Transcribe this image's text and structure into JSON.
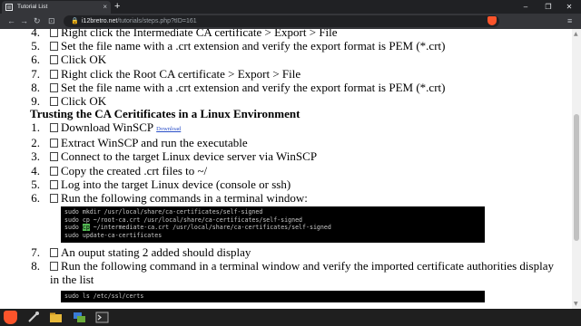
{
  "browser": {
    "tab_title": "Tutorial List",
    "tab_close": "×",
    "new_tab": "+",
    "address_domain": "i12bretro.net",
    "address_path": "/tutorials/steps.php?tID=161",
    "lock": "🔒"
  },
  "nav": {
    "back": "←",
    "forward": "→",
    "reload": "↻",
    "bookmark": "⊡",
    "menu": "≡"
  },
  "window": {
    "minimize": "–",
    "maximize": "❐",
    "close": "✕"
  },
  "list1": [
    {
      "num": "4.",
      "text": "Right click the Intermediate CA certificate > Export > File"
    },
    {
      "num": "5.",
      "text": "Set the file name with a .crt extension and verify the export format is PEM (*.crt)"
    },
    {
      "num": "6.",
      "text": "Click OK"
    },
    {
      "num": "7.",
      "text": "Right click the Root CA certificate > Export > File"
    },
    {
      "num": "8.",
      "text": "Set the file name with a .crt extension and verify the export format is PEM (*.crt)"
    },
    {
      "num": "9.",
      "text": "Click OK"
    }
  ],
  "heading": "Trusting the CA Ceritificates in a Linux Environment",
  "list2": [
    {
      "num": "1.",
      "text": "Download WinSCP",
      "link": "Download"
    },
    {
      "num": "2.",
      "text": "Extract WinSCP and run the executable"
    },
    {
      "num": "3.",
      "text": "Connect to the target Linux device server via WinSCP"
    },
    {
      "num": "4.",
      "text": "Copy the created .crt files to ~/"
    },
    {
      "num": "5.",
      "text": "Log into the target Linux device (console or ssh)"
    },
    {
      "num": "6.",
      "text": "Run the following commands in a terminal window:"
    }
  ],
  "code1": {
    "line1": "sudo mkdir /usr/local/share/ca-certificates/self-signed",
    "line2": "sudo cp ~/root-ca.crt /usr/local/share/ca-certificates/self-signed",
    "line3_pre": "sudo ",
    "line3_hl": "cp",
    "line3_post": " ~/intermediate-ca.crt /usr/local/share/ca-certificates/self-signed",
    "line4": "sudo update-ca-certificates"
  },
  "list3": [
    {
      "num": "7.",
      "text": "An ouput stating 2 added should display"
    },
    {
      "num": "8.",
      "text": "Run the following command in a terminal window and verify the imported certificate authorities display",
      "text2": "in the list"
    }
  ],
  "code2": {
    "line1": "sudo ls /etc/ssl/certs"
  },
  "taskbar": {
    "icons": [
      "brave-icon",
      "tools-icon",
      "folder-icon",
      "winscp-icon",
      "terminal-icon"
    ],
    "colors": {
      "brave": "#fb542b",
      "accent": "#3a7bd5"
    },
    "time": "",
    "date": ""
  }
}
